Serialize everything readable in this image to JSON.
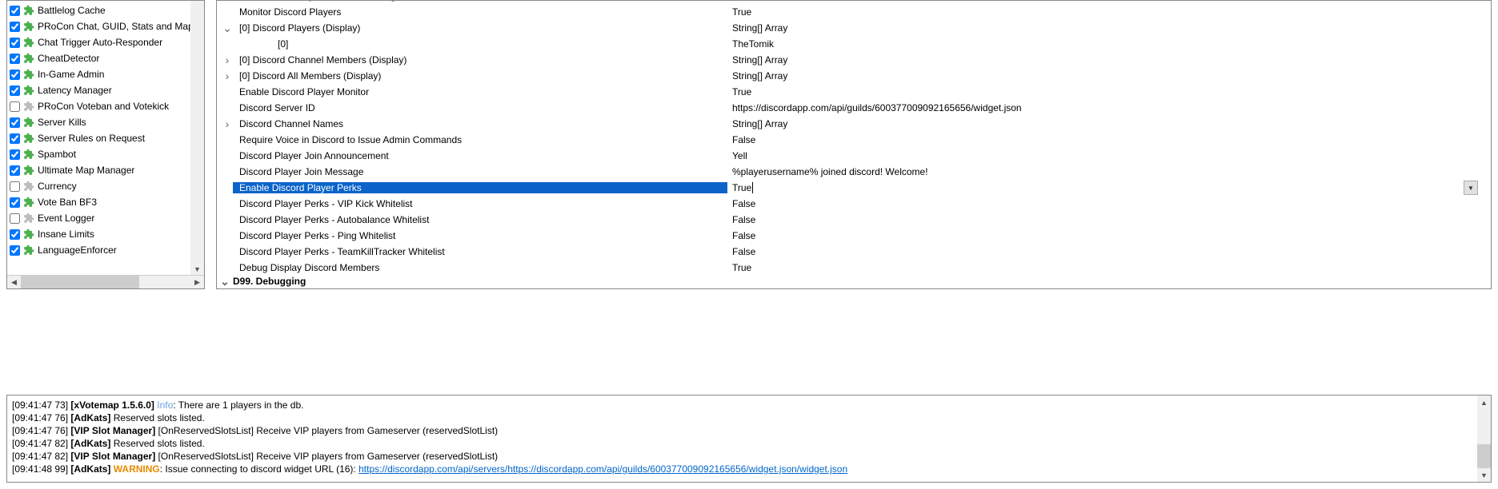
{
  "plugins": [
    {
      "checked": true,
      "enabled": true,
      "label": "Battlelog Cache"
    },
    {
      "checked": true,
      "enabled": true,
      "label": "PRoCon Chat, GUID, Stats and Map"
    },
    {
      "checked": true,
      "enabled": true,
      "label": "Chat Trigger Auto-Responder"
    },
    {
      "checked": true,
      "enabled": true,
      "label": "CheatDetector"
    },
    {
      "checked": true,
      "enabled": true,
      "label": "In-Game Admin"
    },
    {
      "checked": true,
      "enabled": true,
      "label": "Latency Manager"
    },
    {
      "checked": false,
      "enabled": false,
      "label": "PRoCon Voteban and Votekick"
    },
    {
      "checked": true,
      "enabled": true,
      "label": "Server Kills"
    },
    {
      "checked": true,
      "enabled": true,
      "label": "Server Rules on Request"
    },
    {
      "checked": true,
      "enabled": true,
      "label": "Spambot"
    },
    {
      "checked": true,
      "enabled": true,
      "label": "Ultimate Map Manager"
    },
    {
      "checked": false,
      "enabled": false,
      "label": "Currency"
    },
    {
      "checked": true,
      "enabled": true,
      "label": "Vote Ban BF3"
    },
    {
      "checked": false,
      "enabled": false,
      "label": "Event Logger"
    },
    {
      "checked": true,
      "enabled": true,
      "label": "Insane Limits"
    },
    {
      "checked": true,
      "enabled": true,
      "label": "LanguageEnforcer"
    }
  ],
  "settings": [
    {
      "expander": "",
      "indent": 28,
      "key": "Monitor Discord Players",
      "value": "True"
    },
    {
      "expander": "v",
      "indent": 28,
      "key": "[0] Discord Players (Display)",
      "value": "String[] Array"
    },
    {
      "expander": "",
      "indent": 76,
      "key": "[0]",
      "value": "TheTomik"
    },
    {
      "expander": ">",
      "indent": 28,
      "key": "[0] Discord Channel Members (Display)",
      "value": "String[] Array"
    },
    {
      "expander": ">",
      "indent": 28,
      "key": "[0] Discord All Members (Display)",
      "value": "String[] Array"
    },
    {
      "expander": "",
      "indent": 28,
      "key": "Enable Discord Player Monitor",
      "value": "True"
    },
    {
      "expander": "",
      "indent": 28,
      "key": "Discord Server ID",
      "value": "https://discordapp.com/api/guilds/600377009092165656/widget.json"
    },
    {
      "expander": ">",
      "indent": 28,
      "key": "Discord Channel Names",
      "value": "String[] Array"
    },
    {
      "expander": "",
      "indent": 28,
      "key": "Require Voice in Discord to Issue Admin Commands",
      "value": "False"
    },
    {
      "expander": "",
      "indent": 28,
      "key": "Discord Player Join Announcement",
      "value": "Yell"
    },
    {
      "expander": "",
      "indent": 28,
      "key": "Discord Player Join Message",
      "value": "%playerusername% joined discord! Welcome!"
    },
    {
      "expander": "",
      "indent": 28,
      "key": "Enable Discord Player Perks",
      "value": "True",
      "selected": true,
      "editing": true
    },
    {
      "expander": "",
      "indent": 28,
      "key": "Discord Player Perks - VIP Kick Whitelist",
      "value": "False"
    },
    {
      "expander": "",
      "indent": 28,
      "key": "Discord Player Perks - Autobalance Whitelist",
      "value": "False"
    },
    {
      "expander": "",
      "indent": 28,
      "key": "Discord Player Perks - Ping Whitelist",
      "value": "False"
    },
    {
      "expander": "",
      "indent": 28,
      "key": "Discord Player Perks - TeamKillTracker Whitelist",
      "value": "False"
    },
    {
      "expander": "",
      "indent": 28,
      "key": "Debug Display Discord Members",
      "value": "True"
    }
  ],
  "settings_footer": {
    "expander": "v",
    "label": "D99. Debugging"
  },
  "log": [
    {
      "ts": "[09:41:47 73]",
      "tag": "[xVotemap 1.5.6.0]",
      "tag_bold": true,
      "level": "Info",
      "level_class": "info",
      "msg": "There are 1 players in the db."
    },
    {
      "ts": "[09:41:47 76]",
      "tag": "[AdKats]",
      "tag_bold": true,
      "msg": "Reserved slots listed."
    },
    {
      "ts": "[09:41:47 76]",
      "tag": "[VIP Slot Manager]",
      "tag_bold": true,
      "msg": "[OnReservedSlotsList] Receive VIP players from Gameserver (reservedSlotList)"
    },
    {
      "ts": "[09:41:47 82]",
      "tag": "[AdKats]",
      "tag_bold": true,
      "msg": "Reserved slots listed."
    },
    {
      "ts": "[09:41:47 82]",
      "tag": "[VIP Slot Manager]",
      "tag_bold": true,
      "msg": "[OnReservedSlotsList] Receive VIP players from Gameserver (reservedSlotList)"
    },
    {
      "ts": "[09:41:48 99]",
      "tag": "[AdKats]",
      "tag_bold": true,
      "level": "WARNING",
      "level_class": "warning",
      "msg": "Issue connecting to discord widget URL (16): ",
      "link": "https://discordapp.com/api/servers/https://discordapp.com/api/guilds/600377009092165656/widget.json/widget.json"
    }
  ]
}
